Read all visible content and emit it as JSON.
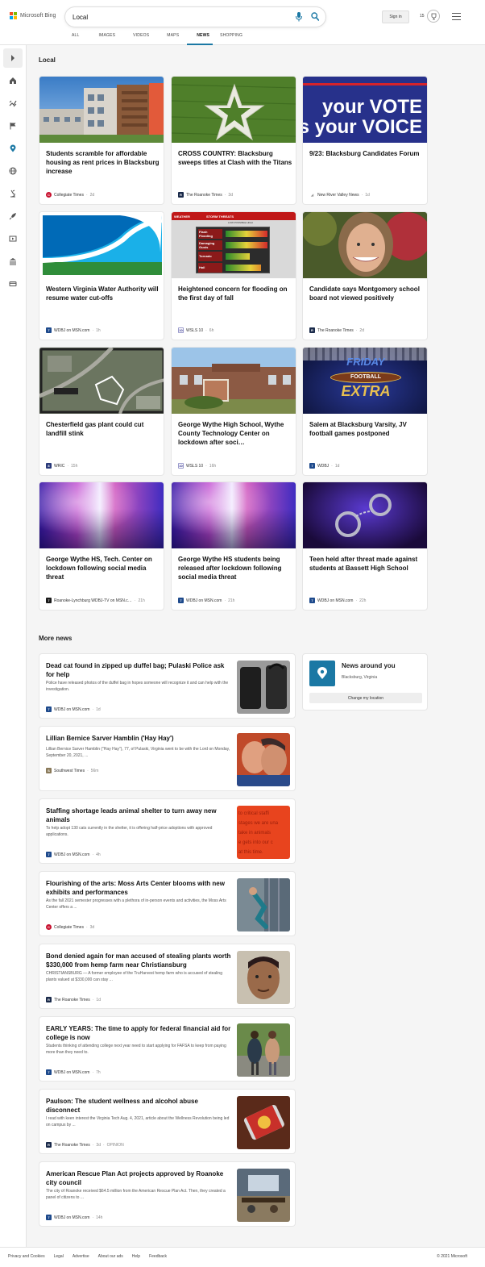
{
  "brand": {
    "name": "Microsoft Bing"
  },
  "search": {
    "query": "Local"
  },
  "header": {
    "signin": "Sign in",
    "rewards": "15"
  },
  "tabs": [
    "ALL",
    "IMAGES",
    "VIDEOS",
    "MAPS",
    "NEWS",
    "SHOPPING"
  ],
  "active_tab": "NEWS",
  "local": {
    "heading": "Local",
    "cards": [
      {
        "title": "Students scramble for affordable housing as rent prices in Blacksburg increase",
        "source": "Collegiate Times",
        "age": "2d"
      },
      {
        "title": "CROSS COUNTRY: Blacksburg sweeps titles at Clash with the Titans",
        "source": "The Roanoke Times",
        "age": "3d"
      },
      {
        "title": "9/23: Blacksburg Candidates Forum",
        "source": "New River Valley News",
        "age": "1d",
        "image_text": [
          "your VOTE",
          "is your VOICE"
        ]
      },
      {
        "title": "Western Virginia Water Authority will resume water cut-offs",
        "source": "WDBJ on MSN.com",
        "age": "1h"
      },
      {
        "title": "Heightened concern for flooding on the first day of fall",
        "source": "WSLS 10",
        "age": "6h",
        "image_text": {
          "weather": "WEATHER",
          "banner": "STORM THREATS",
          "sub": "LOW POSSIBLE HIGH",
          "rows": [
            "Flash Flooding",
            "Damaging Gusts",
            "Tornado",
            "Hail"
          ]
        }
      },
      {
        "title": "Candidate says Montgomery school board not viewed positively",
        "source": "The Roanoke Times",
        "age": "2d"
      },
      {
        "title": "Chesterfield gas plant could cut landfill stink",
        "source": "WRIC",
        "age": "15h"
      },
      {
        "title": "George Wythe High School, Wythe County Technology Center on lockdown after soci…",
        "source": "WSLS 10",
        "age": "16h"
      },
      {
        "title": "Salem at Blacksburg Varsity, JV football games postponed",
        "source": "WDBJ",
        "age": "1d",
        "image_text": [
          "FRIDAY",
          "FOOTBALL",
          "EXTRA"
        ]
      },
      {
        "title": "George Wythe HS, Tech. Center on lockdown following social media threat",
        "source": "Roanoke-Lynchburg WDBJ-TV on MSN.c…",
        "age": "21h"
      },
      {
        "title": "George Wythe HS students being released after lockdown following social media threat",
        "source": "WDBJ on MSN.com",
        "age": "21h"
      },
      {
        "title": "Teen held after threat made against students at Bassett High School",
        "source": "WDBJ on MSN.com",
        "age": "22h"
      }
    ]
  },
  "more_news": {
    "heading": "More news",
    "items": [
      {
        "title": "Dead cat found in zipped up duffel bag; Pulaski Police ask for help",
        "snippet": "Police have released photos of the duffel bag in hopes someone will recognize it and can help with the investigation.",
        "source": "WDBJ on MSN.com",
        "age": "1d"
      },
      {
        "title": "Lillian Bernice Sarver Hamblin ('Hay Hay')",
        "snippet": "Lillian Bernice Sarver Hamblin (\"Hay Hay\"), 77, of Pulaski, Virginia went to be with the Lord on Monday, September 20, 2021, ...",
        "source": "Southwest Times",
        "age": "56m"
      },
      {
        "title": "Staffing shortage leads animal shelter to turn away new animals",
        "snippet": "To help adopt 130 cats currently in the shelter, it is offering half-price adoptions with approved applications.",
        "source": "WDBJ on MSN.com",
        "age": "4h",
        "image_text": [
          "to critical staffi",
          "stages we are una",
          "take in animals",
          "e gets into our c",
          "at this time."
        ]
      },
      {
        "title": "Flourishing of the arts: Moss Arts Center blooms with new exhibits and performances",
        "snippet": "As the fall 2021 semester progresses with a plethora of in-person events and activities, the Moss Arts Center offers a ...",
        "source": "Collegiate Times",
        "age": "3d"
      },
      {
        "title": "Bond denied again for man accused of stealing plants worth $330,000 from hemp farm near Christiansburg",
        "snippet": "CHRISTIANSBURG — A former employee of the TruHarvest hemp farm who is accused of stealing plants valued at $330,000 can stay ...",
        "source": "The Roanoke Times",
        "age": "1d"
      },
      {
        "title": "EARLY YEARS: The time to apply for federal financial aid for college is now",
        "snippet": "Students thinking of attending college next year need to start applying for FAFSA to keep from paying more than they need to.",
        "source": "WDBJ on MSN.com",
        "age": "7h"
      },
      {
        "title": "Paulson: The student wellness and alcohol abuse disconnect",
        "snippet": "I read with keen interest the Virginia Tech Aug. 4, 2021, article about the Wellness Revolution being led on campus by ...",
        "source": "The Roanoke Times",
        "age": "3d",
        "tag": "OPINION"
      },
      {
        "title": "American Rescue Plan Act projects approved by Roanoke city council",
        "snippet": "The city of Roanoke received $64.5 million from the American Rescue Plan Act. Then, they created a panel of citizens to ...",
        "source": "WDBJ on MSN.com",
        "age": "14h"
      }
    ]
  },
  "around": {
    "title": "News around you",
    "location": "Blacksburg, Virginia",
    "button": "Change my location"
  },
  "footer": {
    "links": [
      "Privacy and Cookies",
      "Legal",
      "Advertise",
      "About our ads",
      "Help",
      "Feedback"
    ],
    "copyright": "© 2021 Microsoft"
  },
  "colors": {
    "accent": "#1b78a4",
    "bing_red": "#f25022",
    "bing_green": "#7fba00",
    "bing_blue": "#00a4ef",
    "bing_yellow": "#ffb900"
  }
}
